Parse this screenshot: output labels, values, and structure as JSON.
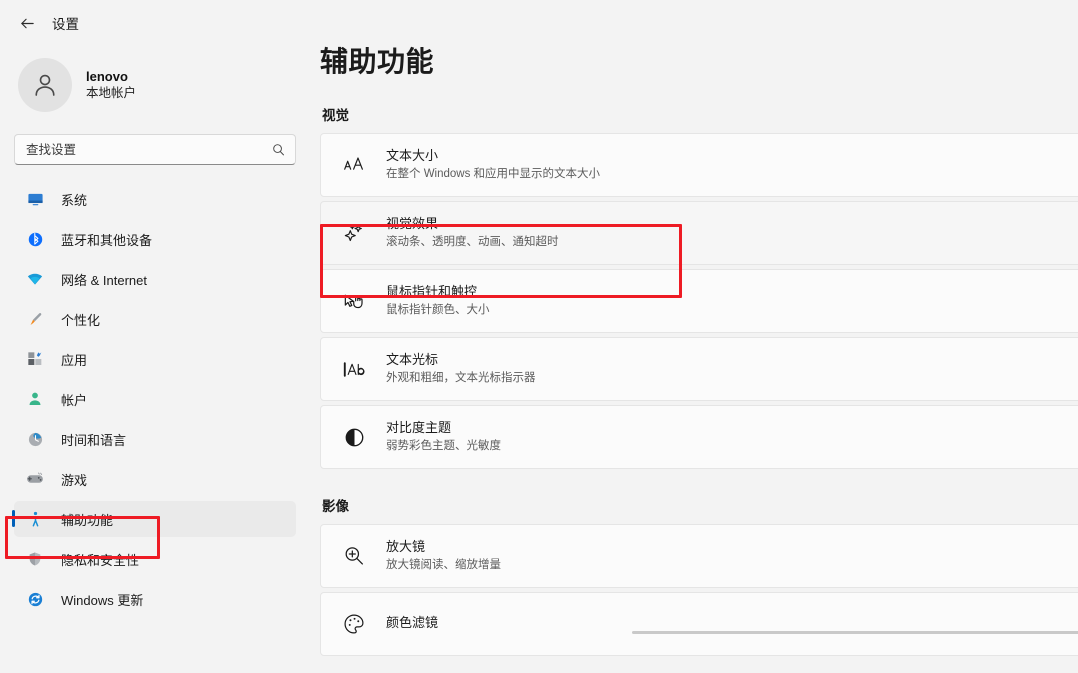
{
  "window": {
    "title": "设置",
    "back_icon": "back-arrow-icon"
  },
  "account": {
    "name": "lenovo",
    "type": "本地帐户",
    "avatar_icon": "person-avatar-icon"
  },
  "search": {
    "placeholder": "查找设置",
    "value": "",
    "icon": "search-icon"
  },
  "sidebar": {
    "items": [
      {
        "label": "系统",
        "icon": "monitor-icon",
        "selected": false
      },
      {
        "label": "蓝牙和其他设备",
        "icon": "bluetooth-icon",
        "selected": false
      },
      {
        "label": "网络 & Internet",
        "icon": "wifi-icon",
        "selected": false
      },
      {
        "label": "个性化",
        "icon": "paintbrush-icon",
        "selected": false
      },
      {
        "label": "应用",
        "icon": "apps-grid-icon",
        "selected": false
      },
      {
        "label": "帐户",
        "icon": "account-person-icon",
        "selected": false
      },
      {
        "label": "时间和语言",
        "icon": "clock-globe-icon",
        "selected": false
      },
      {
        "label": "游戏",
        "icon": "gamepad-icon",
        "selected": false
      },
      {
        "label": "辅助功能",
        "icon": "accessibility-icon",
        "selected": true
      },
      {
        "label": "隐私和安全性",
        "icon": "shield-icon",
        "selected": false
      },
      {
        "label": "Windows 更新",
        "icon": "update-refresh-icon",
        "selected": false
      }
    ]
  },
  "main": {
    "page_title": "辅助功能",
    "sections": [
      {
        "heading": "视觉",
        "rows": [
          {
            "title": "文本大小",
            "subtitle": "在整个 Windows 和应用中显示的文本大小",
            "icon": "text-size-icon",
            "highlighted": false
          },
          {
            "title": "视觉效果",
            "subtitle": "滚动条、透明度、动画、通知超时",
            "icon": "sparkles-icon",
            "highlighted": true
          },
          {
            "title": "鼠标指针和触控",
            "subtitle": "鼠标指针颜色、大小",
            "icon": "mouse-pointer-icon",
            "highlighted": false
          },
          {
            "title": "文本光标",
            "subtitle": "外观和粗细，文本光标指示器",
            "icon": "text-cursor-icon",
            "highlighted": false
          },
          {
            "title": "对比度主题",
            "subtitle": "弱势彩色主题、光敏度",
            "icon": "contrast-icon",
            "highlighted": false
          }
        ]
      },
      {
        "heading": "影像",
        "rows": [
          {
            "title": "放大镜",
            "subtitle": "放大镜阅读、缩放增量",
            "icon": "magnifier-icon",
            "highlighted": false
          },
          {
            "title": "颜色滤镜",
            "subtitle": "",
            "icon": "color-palette-icon",
            "highlighted": false
          }
        ]
      }
    ]
  },
  "annotations": {
    "highlight_color": "#ee1b24",
    "boxes": [
      {
        "target": "sidebar-item-accessibility"
      },
      {
        "target": "card-visual-effects"
      }
    ]
  },
  "theme": {
    "accent": "#005fb8",
    "background": "#f3f3f3",
    "card_background": "#fbfbfb",
    "selected_nav_background": "#eaeaea"
  }
}
